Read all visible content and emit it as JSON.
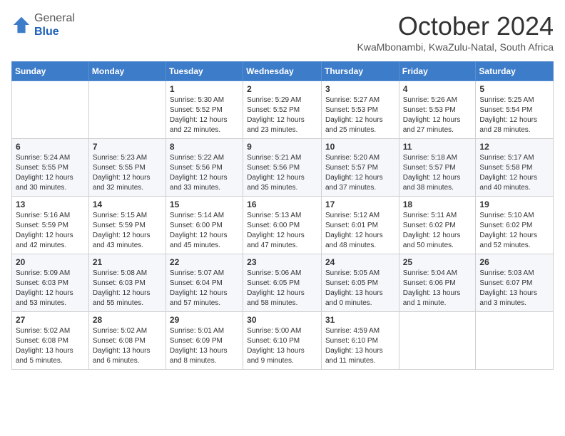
{
  "logo": {
    "general": "General",
    "blue": "Blue"
  },
  "header": {
    "month": "October 2024",
    "location": "KwaMbonambi, KwaZulu-Natal, South Africa"
  },
  "days_of_week": [
    "Sunday",
    "Monday",
    "Tuesday",
    "Wednesday",
    "Thursday",
    "Friday",
    "Saturday"
  ],
  "weeks": [
    [
      {
        "num": "",
        "info": ""
      },
      {
        "num": "",
        "info": ""
      },
      {
        "num": "1",
        "info": "Sunrise: 5:30 AM\nSunset: 5:52 PM\nDaylight: 12 hours and 22 minutes."
      },
      {
        "num": "2",
        "info": "Sunrise: 5:29 AM\nSunset: 5:52 PM\nDaylight: 12 hours and 23 minutes."
      },
      {
        "num": "3",
        "info": "Sunrise: 5:27 AM\nSunset: 5:53 PM\nDaylight: 12 hours and 25 minutes."
      },
      {
        "num": "4",
        "info": "Sunrise: 5:26 AM\nSunset: 5:53 PM\nDaylight: 12 hours and 27 minutes."
      },
      {
        "num": "5",
        "info": "Sunrise: 5:25 AM\nSunset: 5:54 PM\nDaylight: 12 hours and 28 minutes."
      }
    ],
    [
      {
        "num": "6",
        "info": "Sunrise: 5:24 AM\nSunset: 5:55 PM\nDaylight: 12 hours and 30 minutes."
      },
      {
        "num": "7",
        "info": "Sunrise: 5:23 AM\nSunset: 5:55 PM\nDaylight: 12 hours and 32 minutes."
      },
      {
        "num": "8",
        "info": "Sunrise: 5:22 AM\nSunset: 5:56 PM\nDaylight: 12 hours and 33 minutes."
      },
      {
        "num": "9",
        "info": "Sunrise: 5:21 AM\nSunset: 5:56 PM\nDaylight: 12 hours and 35 minutes."
      },
      {
        "num": "10",
        "info": "Sunrise: 5:20 AM\nSunset: 5:57 PM\nDaylight: 12 hours and 37 minutes."
      },
      {
        "num": "11",
        "info": "Sunrise: 5:18 AM\nSunset: 5:57 PM\nDaylight: 12 hours and 38 minutes."
      },
      {
        "num": "12",
        "info": "Sunrise: 5:17 AM\nSunset: 5:58 PM\nDaylight: 12 hours and 40 minutes."
      }
    ],
    [
      {
        "num": "13",
        "info": "Sunrise: 5:16 AM\nSunset: 5:59 PM\nDaylight: 12 hours and 42 minutes."
      },
      {
        "num": "14",
        "info": "Sunrise: 5:15 AM\nSunset: 5:59 PM\nDaylight: 12 hours and 43 minutes."
      },
      {
        "num": "15",
        "info": "Sunrise: 5:14 AM\nSunset: 6:00 PM\nDaylight: 12 hours and 45 minutes."
      },
      {
        "num": "16",
        "info": "Sunrise: 5:13 AM\nSunset: 6:00 PM\nDaylight: 12 hours and 47 minutes."
      },
      {
        "num": "17",
        "info": "Sunrise: 5:12 AM\nSunset: 6:01 PM\nDaylight: 12 hours and 48 minutes."
      },
      {
        "num": "18",
        "info": "Sunrise: 5:11 AM\nSunset: 6:02 PM\nDaylight: 12 hours and 50 minutes."
      },
      {
        "num": "19",
        "info": "Sunrise: 5:10 AM\nSunset: 6:02 PM\nDaylight: 12 hours and 52 minutes."
      }
    ],
    [
      {
        "num": "20",
        "info": "Sunrise: 5:09 AM\nSunset: 6:03 PM\nDaylight: 12 hours and 53 minutes."
      },
      {
        "num": "21",
        "info": "Sunrise: 5:08 AM\nSunset: 6:03 PM\nDaylight: 12 hours and 55 minutes."
      },
      {
        "num": "22",
        "info": "Sunrise: 5:07 AM\nSunset: 6:04 PM\nDaylight: 12 hours and 57 minutes."
      },
      {
        "num": "23",
        "info": "Sunrise: 5:06 AM\nSunset: 6:05 PM\nDaylight: 12 hours and 58 minutes."
      },
      {
        "num": "24",
        "info": "Sunrise: 5:05 AM\nSunset: 6:05 PM\nDaylight: 13 hours and 0 minutes."
      },
      {
        "num": "25",
        "info": "Sunrise: 5:04 AM\nSunset: 6:06 PM\nDaylight: 13 hours and 1 minute."
      },
      {
        "num": "26",
        "info": "Sunrise: 5:03 AM\nSunset: 6:07 PM\nDaylight: 13 hours and 3 minutes."
      }
    ],
    [
      {
        "num": "27",
        "info": "Sunrise: 5:02 AM\nSunset: 6:08 PM\nDaylight: 13 hours and 5 minutes."
      },
      {
        "num": "28",
        "info": "Sunrise: 5:02 AM\nSunset: 6:08 PM\nDaylight: 13 hours and 6 minutes."
      },
      {
        "num": "29",
        "info": "Sunrise: 5:01 AM\nSunset: 6:09 PM\nDaylight: 13 hours and 8 minutes."
      },
      {
        "num": "30",
        "info": "Sunrise: 5:00 AM\nSunset: 6:10 PM\nDaylight: 13 hours and 9 minutes."
      },
      {
        "num": "31",
        "info": "Sunrise: 4:59 AM\nSunset: 6:10 PM\nDaylight: 13 hours and 11 minutes."
      },
      {
        "num": "",
        "info": ""
      },
      {
        "num": "",
        "info": ""
      }
    ]
  ]
}
